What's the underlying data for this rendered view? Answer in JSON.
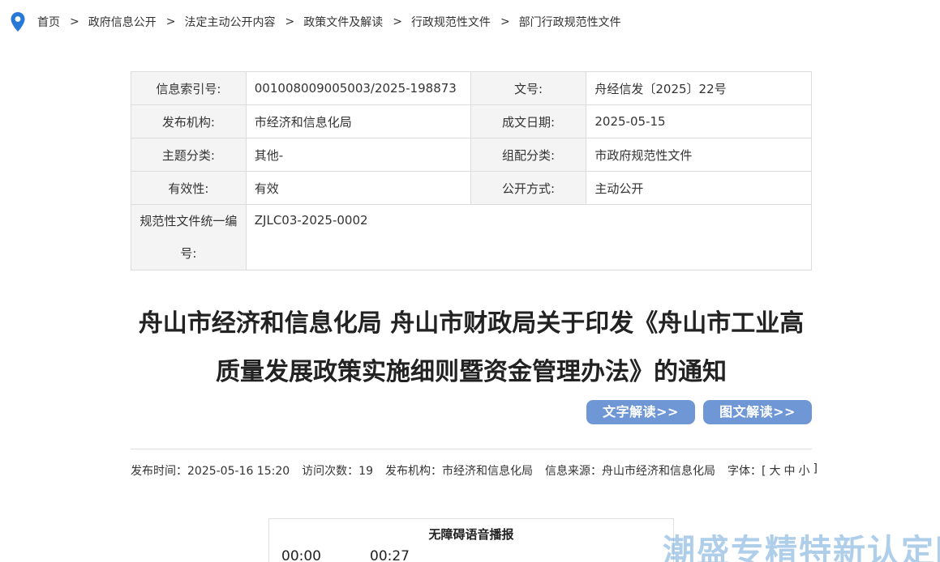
{
  "breadcrumb": {
    "items": [
      "首页",
      "政府信息公开",
      "法定主动公开内容",
      "政策文件及解读",
      "行政规范性文件",
      "部门行政规范性文件"
    ],
    "separator": ">"
  },
  "meta": {
    "index_label": "信息索引号:",
    "index_value": "001008009005003/2025-198873",
    "docno_label": "文号:",
    "docno_value": "舟经信发〔2025〕22号",
    "org_label": "发布机构:",
    "org_value": "市经济和信息化局",
    "date_label": "成文日期:",
    "date_value": "2025-05-15",
    "topic_label": "主题分类:",
    "topic_value": "其他-",
    "group_label": "组配分类:",
    "group_value": "市政府规范性文件",
    "valid_label": "有效性:",
    "valid_value": "有效",
    "disclose_label": "公开方式:",
    "disclose_value": "主动公开",
    "code_label": "规范性文件统一编号:",
    "code_value": "ZJLC03-2025-0002"
  },
  "title": {
    "line1": "舟山市经济和信息化局 舟山市财政局关于印发《舟山市工业高",
    "line2": "质量发展政策实施细则暨资金管理办法》的通知"
  },
  "buttons": {
    "text_read": "文字解读>>",
    "image_read": "图文解读>>"
  },
  "info": {
    "publish_time": "发布时间：2025-05-16 15:20",
    "visits": "访问次数：19",
    "org": "发布机构：市经济和信息化局",
    "source": "信息来源：舟山市经济和信息化局",
    "font_label": "字体：[",
    "font_large": "大",
    "font_medium": "中",
    "font_small": "小",
    "font_close": "]"
  },
  "audio": {
    "title": "无障碍语音播报",
    "current_time": "00:00",
    "total_time": "00:27"
  },
  "watermark": "潮盛专精特新认定网",
  "colors": {
    "accent": "#2878d8",
    "button": "#6f97d6",
    "label_bg": "#f4f4f4"
  }
}
